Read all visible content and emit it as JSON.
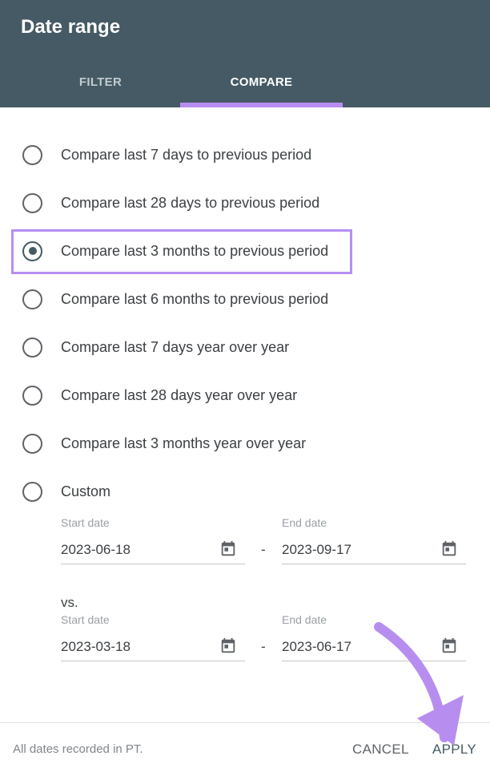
{
  "dialog": {
    "title": "Date range"
  },
  "tabs": [
    {
      "label": "FILTER",
      "active": false
    },
    {
      "label": "COMPARE",
      "active": true
    }
  ],
  "options": [
    {
      "label": "Compare last 7 days to previous period",
      "selected": false
    },
    {
      "label": "Compare last 28 days to previous period",
      "selected": false
    },
    {
      "label": "Compare last 3 months to previous period",
      "selected": true
    },
    {
      "label": "Compare last 6 months to previous period",
      "selected": false
    },
    {
      "label": "Compare last 7 days year over year",
      "selected": false
    },
    {
      "label": "Compare last 28 days year over year",
      "selected": false
    },
    {
      "label": "Compare last 3 months year over year",
      "selected": false
    },
    {
      "label": "Custom",
      "selected": false
    }
  ],
  "custom": {
    "range1": {
      "start_label": "Start date",
      "start_value": "2023-06-18",
      "end_label": "End date",
      "end_value": "2023-09-17"
    },
    "separator": "-",
    "vs_label": "vs.",
    "range2": {
      "start_label": "Start date",
      "start_value": "2023-03-18",
      "end_label": "End date",
      "end_value": "2023-06-17"
    }
  },
  "footer": {
    "note": "All dates recorded in PT.",
    "cancel_label": "CANCEL",
    "apply_label": "APPLY"
  },
  "colors": {
    "header_bg": "#455a64",
    "highlight": "#b78ef0",
    "text": "#3c4043"
  },
  "icons": {
    "calendar": "calendar-icon",
    "annotation": "annotation-arrow"
  }
}
